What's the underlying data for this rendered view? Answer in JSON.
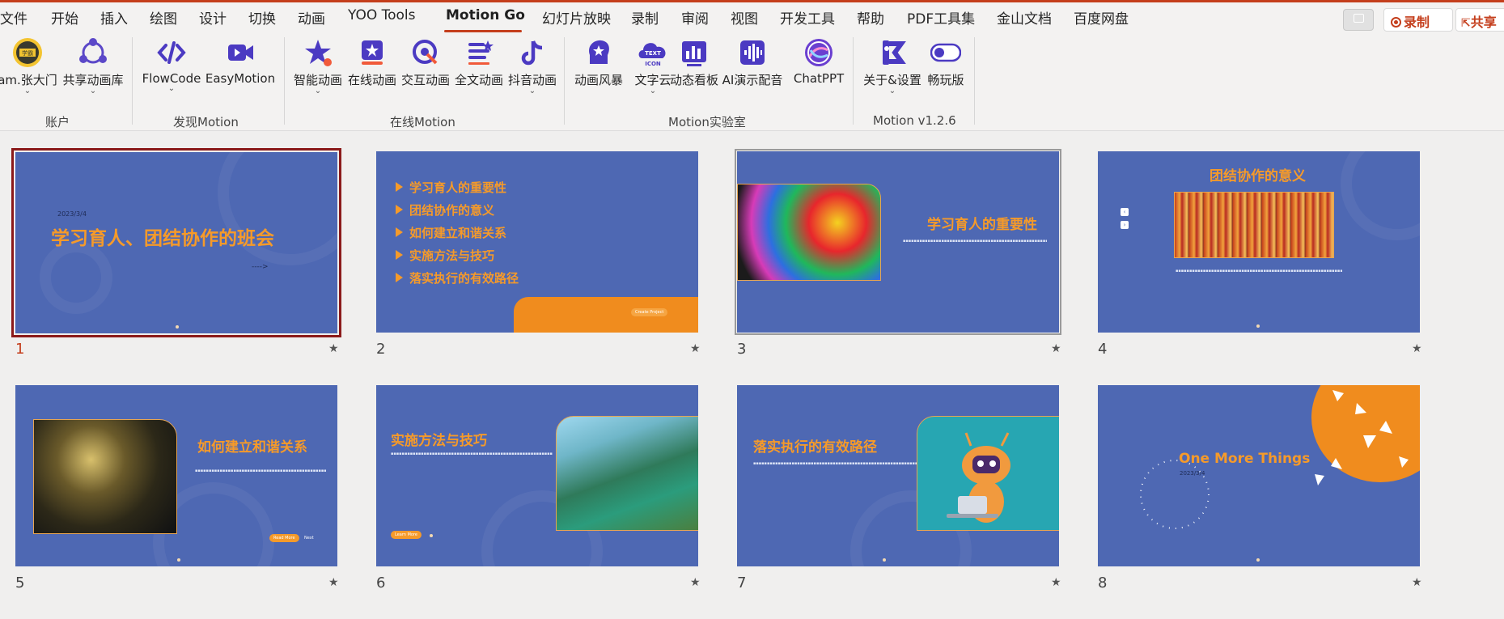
{
  "menu_tabs": [
    "文件",
    "开始",
    "插入",
    "绘图",
    "设计",
    "切换",
    "动画",
    "YOO Tools",
    "Motion Go",
    "幻灯片放映",
    "录制",
    "审阅",
    "视图",
    "开发工具",
    "帮助",
    "PDF工具集",
    "金山文档",
    "百度网盘"
  ],
  "active_tab": "Motion Go",
  "top_right": {
    "record_label": "录制",
    "share_label": "共享"
  },
  "ribbon": {
    "groups": [
      {
        "label": "账户",
        "buttons": [
          "am.张大门",
          "共享动画库"
        ]
      },
      {
        "label": "发现Motion",
        "buttons": [
          "FlowCode",
          "EasyMotion"
        ]
      },
      {
        "label": "在线Motion",
        "buttons": [
          "智能动画",
          "在线动画",
          "交互动画",
          "全文动画",
          "抖音动画"
        ]
      },
      {
        "label": "Motion实验室",
        "buttons": [
          "动画风暴",
          "文字云",
          "动态看板",
          "AI演示配音",
          "ChatPPT"
        ]
      },
      {
        "label": "Motion v1.2.6",
        "buttons": [
          "关于&设置",
          "畅玩版"
        ]
      }
    ],
    "icon_names": {
      "text_cloud_badge": "TEXT",
      "text_cloud_sub": "ICON"
    }
  },
  "slides": [
    {
      "number": "1",
      "date": "2023/3/4",
      "title": "学习育人、团结协作的班会",
      "arrow_text": "---->"
    },
    {
      "number": "2",
      "toc": [
        "学习育人的重要性",
        "团结协作的意义",
        "如何建立和谐关系",
        "实施方法与技巧",
        "落实执行的有效路径"
      ],
      "button": "Create Project"
    },
    {
      "number": "3",
      "title": "学习育人的重要性"
    },
    {
      "number": "4",
      "title": "团结协作的意义"
    },
    {
      "number": "5",
      "title": "如何建立和谐关系",
      "button": "Read More",
      "link": "Next"
    },
    {
      "number": "6",
      "title": "实施方法与技巧",
      "button": "Learn More"
    },
    {
      "number": "7",
      "title": "落实执行的有效路径"
    },
    {
      "number": "8",
      "title": "One More Things",
      "date": "2023/3/4"
    }
  ],
  "colors": {
    "accent": "#c43e1c",
    "slide_bg": "#4e68b3",
    "slide_title": "#f59a2a"
  }
}
